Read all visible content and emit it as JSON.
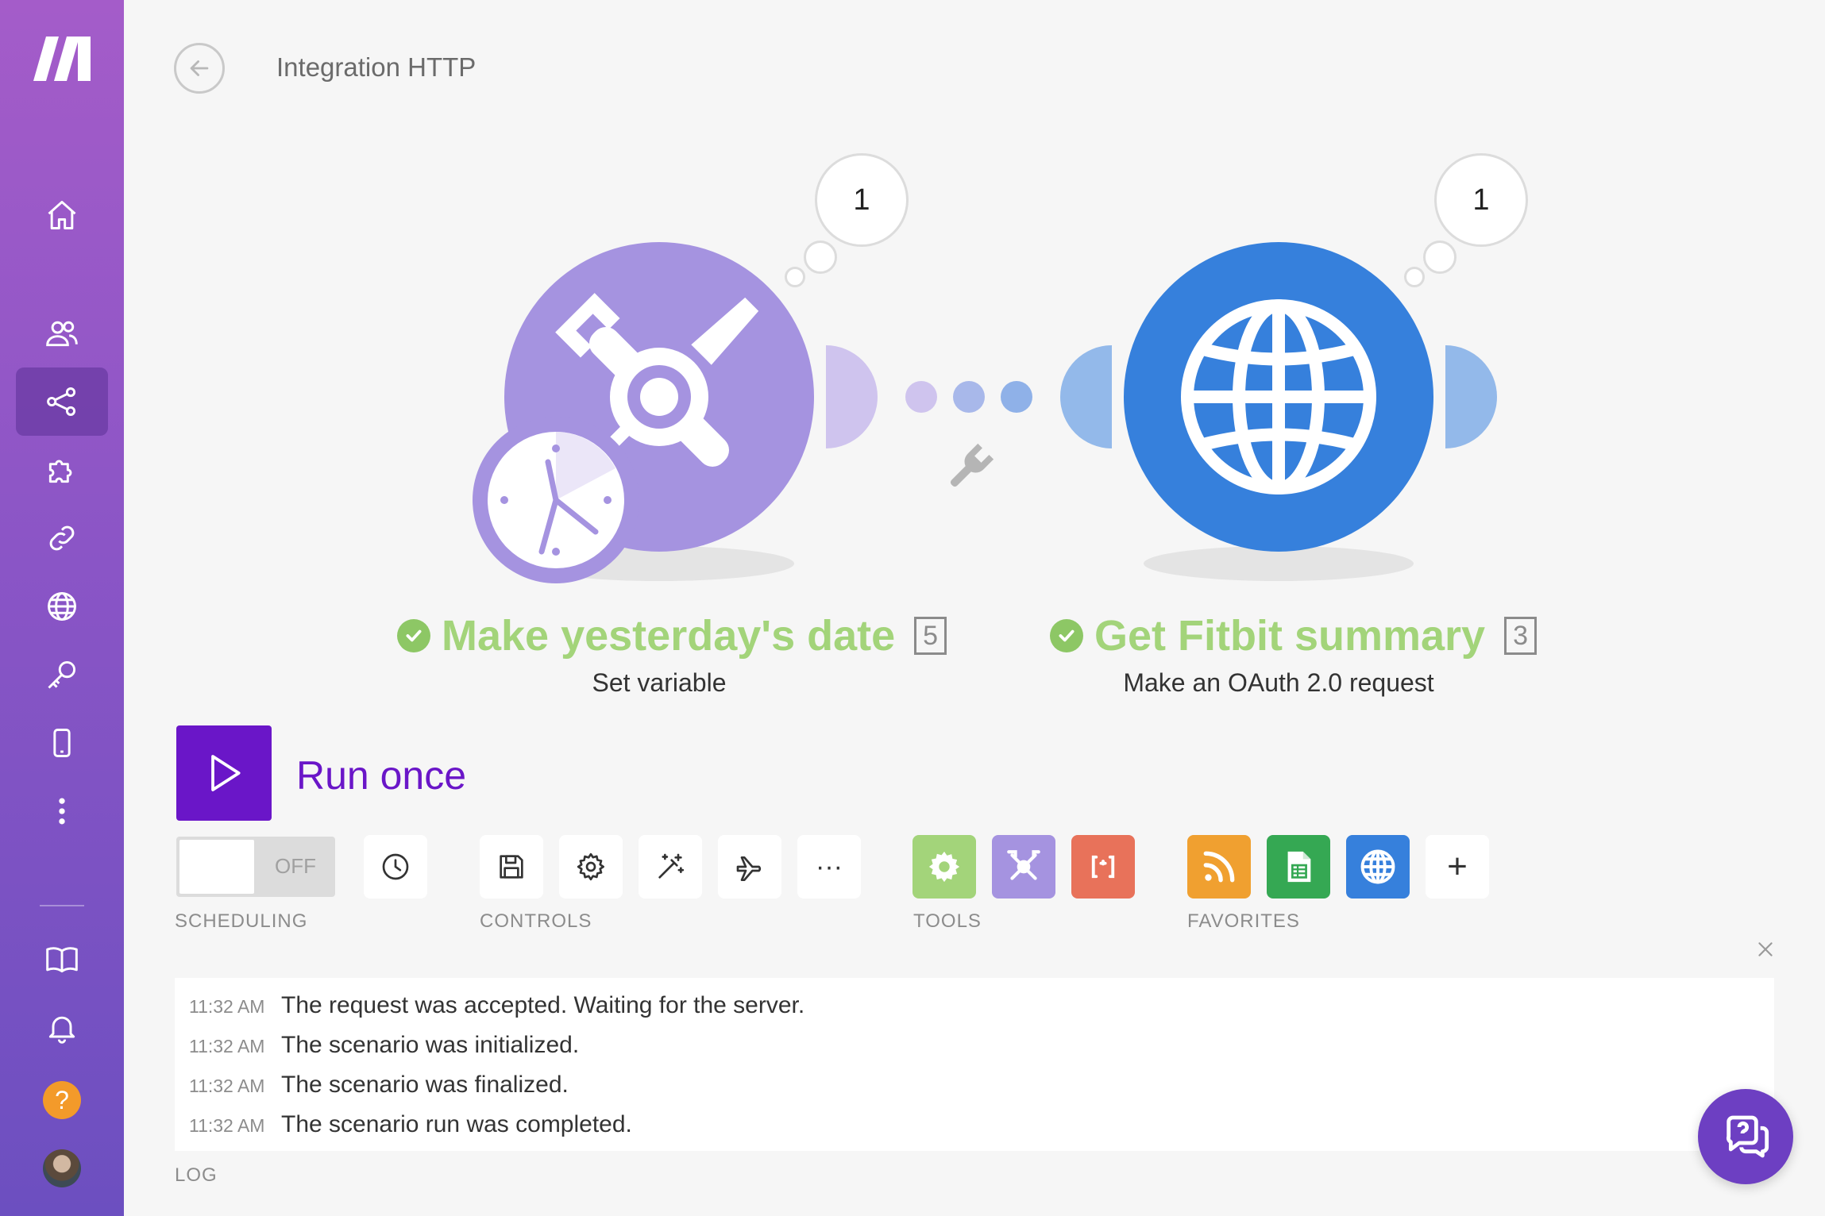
{
  "app": {
    "page_title": "Integration HTTP"
  },
  "sidebar": {
    "items": [
      {
        "id": "home",
        "icon": "home-icon"
      },
      {
        "id": "team",
        "icon": "users-icon"
      },
      {
        "id": "scenarios",
        "icon": "share-icon",
        "active": true
      },
      {
        "id": "templates",
        "icon": "puzzle-icon"
      },
      {
        "id": "connections",
        "icon": "link-icon"
      },
      {
        "id": "webhooks",
        "icon": "globe-icon"
      },
      {
        "id": "keys",
        "icon": "key-icon"
      },
      {
        "id": "devices",
        "icon": "device-icon"
      },
      {
        "id": "more",
        "icon": "more-vertical-icon"
      },
      {
        "id": "docs",
        "icon": "book-icon"
      },
      {
        "id": "notifications",
        "icon": "bell-icon"
      }
    ],
    "help_glyph": "?"
  },
  "modules": [
    {
      "name": "Make yesterday's date",
      "subtitle": "Set variable",
      "id_badge": "5",
      "operations": "1",
      "color": "#a593e0"
    },
    {
      "name": "Get Fitbit summary",
      "subtitle": "Make an OAuth 2.0 request",
      "id_badge": "3",
      "operations": "1",
      "color": "#3680dc"
    }
  ],
  "run": {
    "label": "Run once",
    "color": "#6a16c8"
  },
  "scheduling": {
    "label": "SCHEDULING",
    "toggle_state": "OFF"
  },
  "controls": {
    "label": "CONTROLS",
    "icons": [
      "save-icon",
      "gear-icon",
      "magic-wand-icon",
      "airplane-icon",
      "more-horizontal-icon"
    ],
    "more_glyph": "···"
  },
  "tools": {
    "label": "TOOLS",
    "items": [
      {
        "icon": "gear-icon",
        "color": "#a3d47a"
      },
      {
        "icon": "tools-icon",
        "color": "#a593e0"
      },
      {
        "icon": "json-icon",
        "color": "#e8725a"
      }
    ]
  },
  "favorites": {
    "label": "FAVORITES",
    "items": [
      {
        "icon": "rss-icon",
        "color": "#f0a030"
      },
      {
        "icon": "sheets-icon",
        "color": "#35a853"
      },
      {
        "icon": "globe-icon",
        "color": "#3680dc"
      }
    ],
    "add_glyph": "+"
  },
  "log": {
    "label": "LOG",
    "entries": [
      {
        "time": "11:32 AM",
        "message": "The request was accepted. Waiting for the server."
      },
      {
        "time": "11:32 AM",
        "message": "The scenario was initialized."
      },
      {
        "time": "11:32 AM",
        "message": "The scenario was finalized."
      },
      {
        "time": "11:32 AM",
        "message": "The scenario run was completed."
      }
    ]
  }
}
